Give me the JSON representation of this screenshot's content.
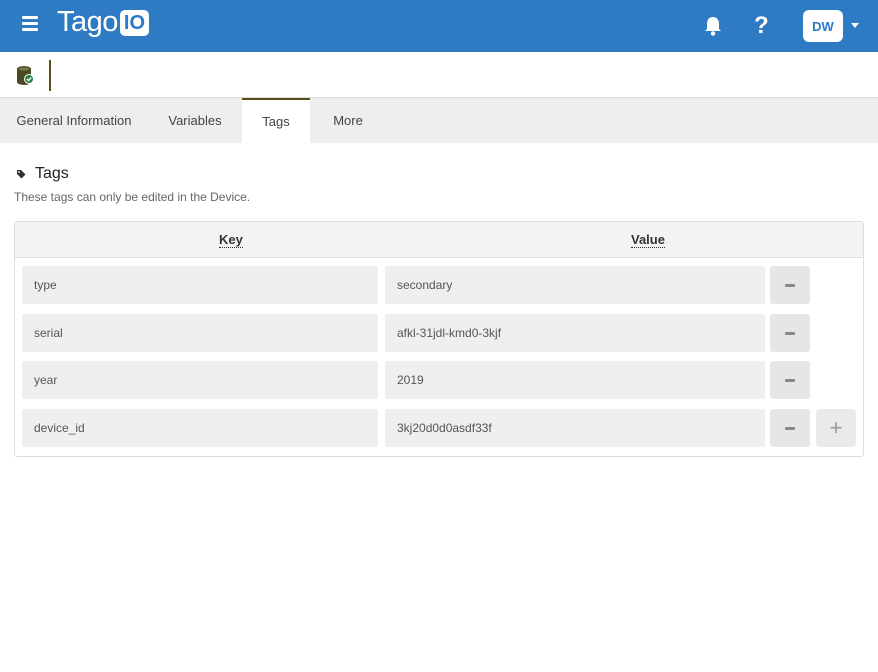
{
  "app": {
    "brand_text": "Tago",
    "brand_badge": "IO",
    "user_initials": "DW",
    "help_label": "?"
  },
  "colors": {
    "topbar": "#2e7bc4",
    "accent": "#5b4d1a",
    "tab_bar": "#eeeeee"
  },
  "tabs": [
    {
      "label": "General Information",
      "active": false
    },
    {
      "label": "Variables",
      "active": false
    },
    {
      "label": "Tags",
      "active": true
    },
    {
      "label": "More",
      "active": false
    }
  ],
  "section": {
    "title": "Tags",
    "subtitle": "These tags can only be edited in the Device."
  },
  "table": {
    "headers": {
      "key": "Key",
      "value": "Value"
    },
    "rows": [
      {
        "key": "type",
        "value": "secondary"
      },
      {
        "key": "serial",
        "value": "afkl-31jdl-kmd0-3kjf"
      },
      {
        "key": "year",
        "value": "2019"
      },
      {
        "key": "device_id",
        "value": "3kj20d0d0asdf33f"
      }
    ],
    "add_label": "+"
  },
  "icons": [
    "menu-icon",
    "bell-icon",
    "help-icon",
    "caret-down-icon",
    "device-icon",
    "tag-icon",
    "minus-icon",
    "plus-icon"
  ]
}
